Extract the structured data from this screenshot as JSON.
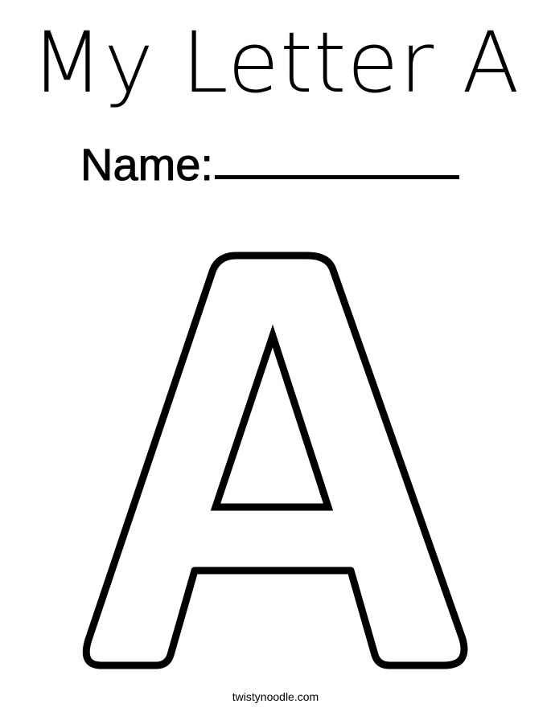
{
  "worksheet": {
    "title": "My Letter A",
    "name_label": "Name:",
    "name_field_value": "",
    "letter": "A",
    "footer": "twistynoodle.com"
  },
  "colors": {
    "background": "#ffffff",
    "ink": "#000000"
  }
}
